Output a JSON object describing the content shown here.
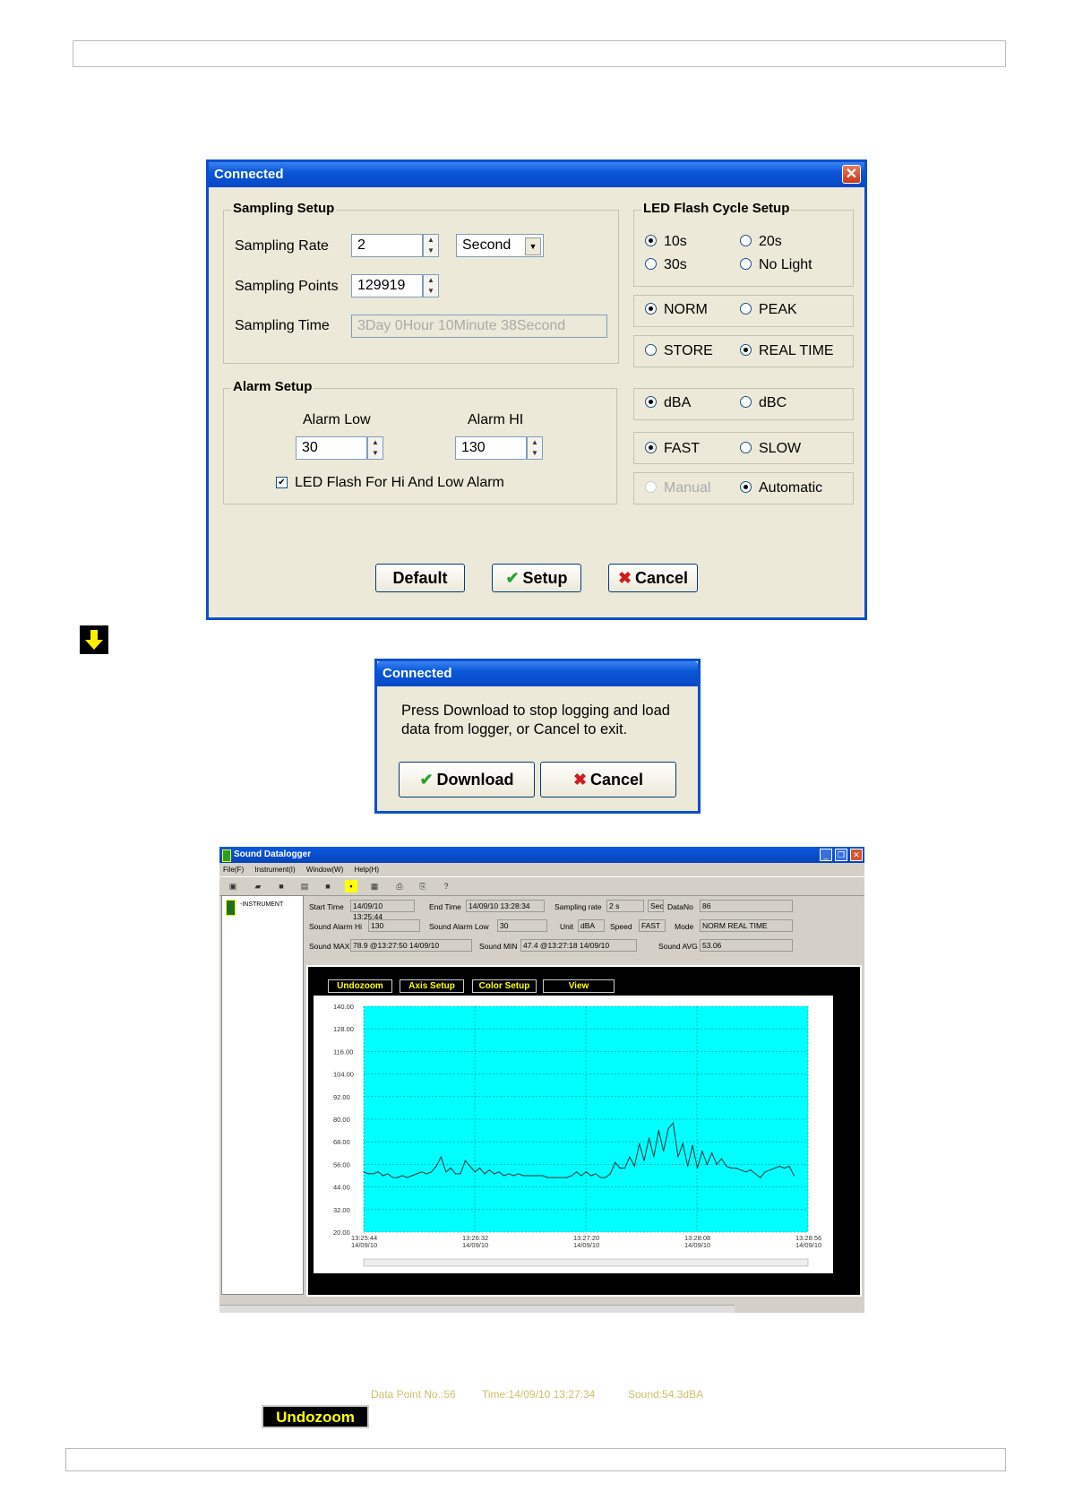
{
  "setup_dialog": {
    "title": "Connected",
    "sampling_setup": {
      "legend": "Sampling Setup",
      "rate_label": "Sampling Rate",
      "rate_value": "2",
      "rate_unit": "Second",
      "points_label": "Sampling Points",
      "points_value": "129919",
      "time_label": "Sampling Time",
      "time_value": "3Day 0Hour 10Minute 38Second"
    },
    "led_setup": {
      "legend": "LED Flash Cycle Setup",
      "opt_10s": "10s",
      "opt_20s": "20s",
      "opt_30s": "30s",
      "opt_nolight": "No Light"
    },
    "norm": "NORM",
    "peak": "PEAK",
    "store": "STORE",
    "realtime": "REAL TIME",
    "dba": "dBA",
    "dbc": "dBC",
    "fast": "FAST",
    "slow": "SLOW",
    "manual": "Manual",
    "automatic": "Automatic",
    "alarm_setup": {
      "legend": "Alarm Setup",
      "low_label": "Alarm Low",
      "low_value": "30",
      "hi_label": "Alarm HI",
      "hi_value": "130",
      "led_flash_label": "LED Flash For Hi And Low  Alarm"
    },
    "buttons": {
      "default": "Default",
      "setup": "Setup",
      "cancel": "Cancel"
    }
  },
  "connected_dialog": {
    "title": "Connected",
    "message": "Press Download to stop logging and load data from logger, or Cancel to exit.",
    "download": "Download",
    "cancel": "Cancel"
  },
  "app": {
    "title": "Sound Datalogger",
    "menu": [
      "File(F)",
      "Instrument(I)",
      "Window(W)",
      "Help(H)"
    ],
    "tree_item": "-INSTRUMENT",
    "labels": {
      "start_time": "Start Time",
      "end_time": "End Time",
      "sampling_rate": "Sampling rate",
      "sec": "Sec",
      "datano": "DataNo",
      "alarm_hi": "Sound Alarm Hi",
      "alarm_low": "Sound Alarm Low",
      "unit": "Unit",
      "speed": "Speed",
      "mode": "Mode",
      "max": "Sound MAX",
      "min": "Sound MIN",
      "avg": "Sound AVG"
    },
    "values": {
      "start_time": "14/09/10 13:25:44",
      "end_time": "14/09/10 13:28:34",
      "sampling_rate": "2 s",
      "datano": "86",
      "alarm_hi": "130",
      "alarm_low": "30",
      "unit": "dBA",
      "speed": "FAST",
      "mode": "NORM REAL TIME",
      "max": "78.9 @13:27:50 14/09/10",
      "min": "47.4 @13:27:18 14/09/10",
      "avg": "53.06"
    },
    "plot_buttons": [
      "Undozoom",
      "Axis Setup",
      "Color Setup",
      "View"
    ],
    "status": {
      "point": "Data Point No.:56",
      "time": "Time:14/09/10 13:27:34",
      "sound": "Sound:54.3dBA"
    },
    "colors": {
      "plot_bg": "#00ffff",
      "frame": "#000000",
      "button_text": "#ffff00"
    }
  },
  "chart_data": {
    "type": "line",
    "ylim": [
      20,
      140
    ],
    "yticks": [
      "140.00",
      "128.00",
      "116.00",
      "104.00",
      "92.00",
      "80.00",
      "68.00",
      "56.00",
      "44.00",
      "32.00",
      "20.00"
    ],
    "xticks": [
      {
        "time": "13:25:44",
        "date": "14/09/10"
      },
      {
        "time": "13:26:32",
        "date": "14/09/10"
      },
      {
        "time": "13:27:20",
        "date": "14/09/10"
      },
      {
        "time": "13:28:08",
        "date": "14/09/10"
      },
      {
        "time": "13:28:56",
        "date": "14/09/10"
      }
    ],
    "x_seconds_range": [
      0,
      192
    ],
    "series": [
      {
        "values": [
          52,
          51,
          51,
          52,
          50,
          51,
          49,
          49,
          50,
          49,
          50,
          51,
          52,
          51,
          52,
          55,
          60,
          52,
          54,
          51,
          51,
          58,
          55,
          52,
          54,
          51,
          53,
          51,
          52,
          50,
          51,
          50,
          51,
          50,
          50,
          50,
          50,
          50,
          49,
          49,
          49,
          49,
          49,
          50,
          52,
          50,
          52,
          50,
          51,
          49,
          49,
          51,
          57,
          54,
          54,
          60,
          55,
          67,
          58,
          70,
          60,
          74,
          63,
          75,
          78,
          60,
          67,
          55,
          66,
          54,
          63,
          56,
          62,
          56,
          59,
          55,
          54,
          54,
          53,
          52,
          53,
          51,
          49,
          52,
          53,
          54,
          55,
          54,
          55,
          50
        ]
      }
    ]
  },
  "footer_button": "Undozoom"
}
